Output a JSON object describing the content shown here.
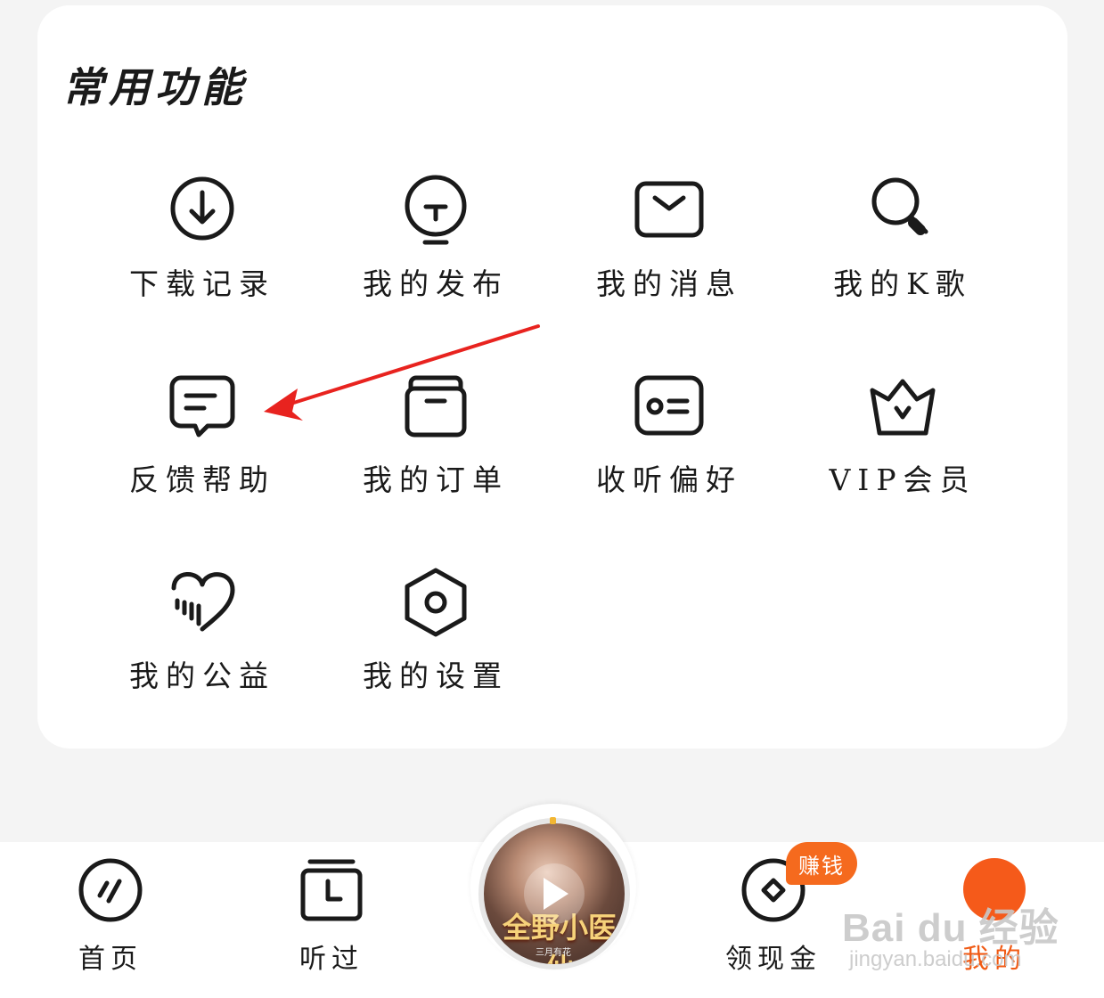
{
  "section": {
    "title": "常用功能",
    "items": [
      {
        "label": "下载记录",
        "icon": "download-icon"
      },
      {
        "label": "我的发布",
        "icon": "publish-icon"
      },
      {
        "label": "我的消息",
        "icon": "message-icon"
      },
      {
        "label": "我的K歌",
        "icon": "karaoke-icon"
      },
      {
        "label": "反馈帮助",
        "icon": "feedback-icon"
      },
      {
        "label": "我的订单",
        "icon": "order-icon"
      },
      {
        "label": "收听偏好",
        "icon": "preference-icon"
      },
      {
        "label": "VIP会员",
        "icon": "vip-crown-icon"
      },
      {
        "label": "我的公益",
        "icon": "charity-heart-icon"
      },
      {
        "label": "我的设置",
        "icon": "settings-icon"
      }
    ]
  },
  "tabbar": {
    "tabs": [
      {
        "label": "首页",
        "icon": "home-icon"
      },
      {
        "label": "听过",
        "icon": "history-icon"
      },
      {
        "label": "领现金",
        "icon": "cash-coin-icon"
      },
      {
        "label": "我的",
        "icon": "profile-icon"
      }
    ],
    "badge": "赚钱",
    "player": {
      "cover_title": "全野小医仙",
      "cover_author": "三月有花",
      "icon": "play-icon"
    }
  },
  "annotation": {
    "color": "#e8231f"
  },
  "colors": {
    "accent": "#f05a14",
    "badge": "#f56a1e"
  },
  "watermark": {
    "logo": "Bai du 经验",
    "sub": "jingyan.baidu.com"
  }
}
